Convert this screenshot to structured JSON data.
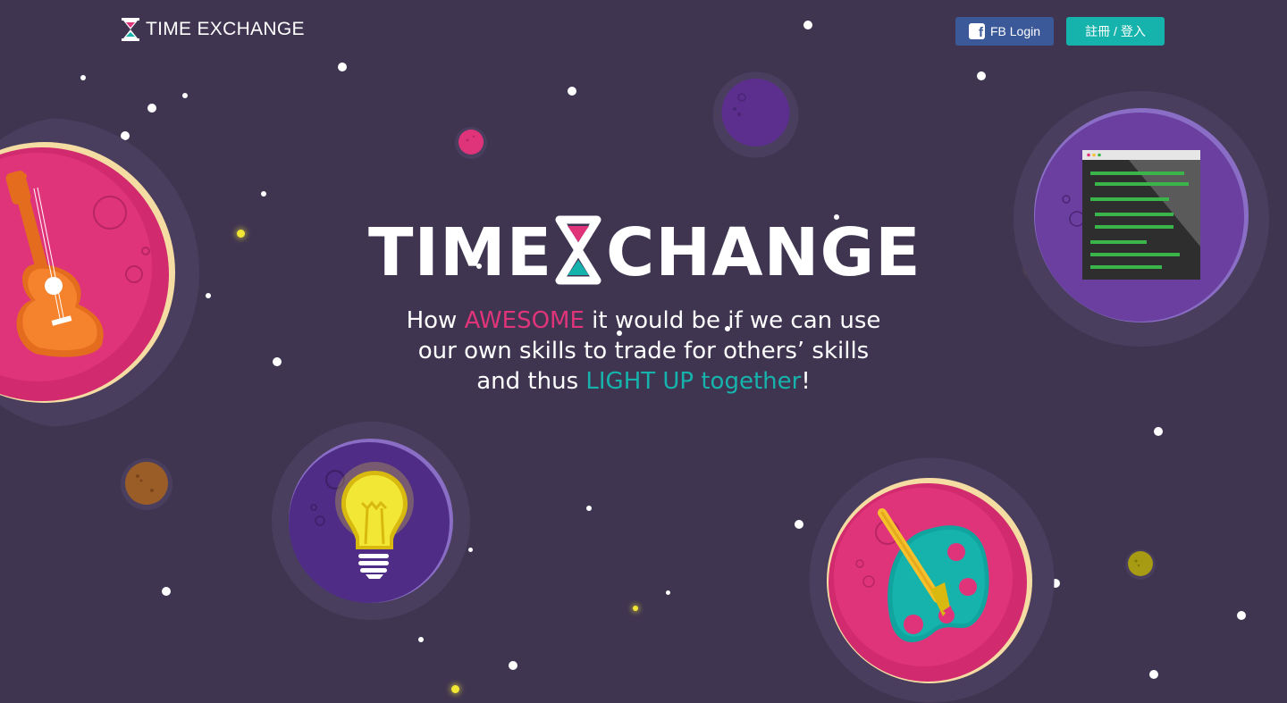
{
  "header": {
    "logo_text": "TIME EXCHANGE",
    "fb_login_label": "FB Login",
    "register_login_label": "註冊 / 登入"
  },
  "hero": {
    "title_left": "TIME",
    "title_right": "CHANGE",
    "tagline": {
      "line1_pre": "How ",
      "line1_highlight": "AWESOME",
      "line1_post": " it would be if we can use",
      "line2": "our own skills to trade for others’ skills",
      "line3_pre": "and thus ",
      "line3_highlight": "LIGHT UP together",
      "line3_post": "!"
    }
  },
  "icons": [
    "hourglass-icon",
    "facebook-icon",
    "guitar-icon",
    "code-window-icon",
    "lightbulb-icon",
    "palette-icon"
  ],
  "colors": {
    "background": "#3f3551",
    "pink": "#e0347a",
    "teal": "#16b3ad",
    "facebook": "#3b5998",
    "purple_planet": "#6a3fa0",
    "star_yellow": "#f3e736"
  }
}
